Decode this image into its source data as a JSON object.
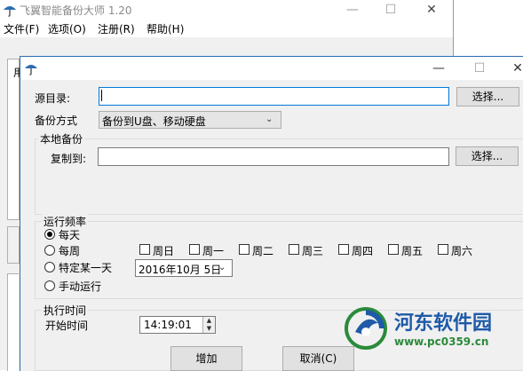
{
  "main_window": {
    "title": "飞翼智能备份大师 1.20",
    "controls": {
      "minimize": "—",
      "maximize": "☐",
      "close": "✕"
    },
    "menu": [
      {
        "label": "文件(F)"
      },
      {
        "label": "选项(O)"
      },
      {
        "label": "注册(R)"
      },
      {
        "label": "帮助(H)"
      }
    ],
    "panel_partial_label": "用"
  },
  "dialog": {
    "title": "",
    "controls": {
      "minimize": "—",
      "maximize": "☐",
      "close": "✕"
    },
    "source_dir": {
      "label": "源目录:",
      "value": "",
      "browse_label": "选择..."
    },
    "backup_mode": {
      "label": "备份方式",
      "selected": "备份到U盘、移动硬盘"
    },
    "local_backup": {
      "group_label": "本地备份",
      "copy_to_label": "复制到:",
      "copy_to_value": "",
      "browse_label": "选择..."
    },
    "frequency": {
      "group_label": "运行频率",
      "options": [
        {
          "label": "每天",
          "checked": true
        },
        {
          "label": "每周",
          "checked": false
        },
        {
          "label": "特定某一天",
          "checked": false
        },
        {
          "label": "手动运行",
          "checked": false
        }
      ],
      "weekdays": [
        {
          "label": "周日",
          "checked": false
        },
        {
          "label": "周一",
          "checked": false
        },
        {
          "label": "周二",
          "checked": false
        },
        {
          "label": "周三",
          "checked": false
        },
        {
          "label": "周四",
          "checked": false
        },
        {
          "label": "周五",
          "checked": false
        },
        {
          "label": "周六",
          "checked": false
        }
      ],
      "specific_date": "2016年10月  5日"
    },
    "exec_time": {
      "group_label": "执行时间",
      "start_label": "开始时间",
      "start_value": "14:19:01"
    },
    "buttons": {
      "add": "增加",
      "cancel": "取消(C)"
    }
  },
  "watermark": {
    "text": "河东软件园",
    "url": "www.pc0359.cn"
  },
  "colors": {
    "focus_border": "#0078d7",
    "dialog_border": "#2b6cb0",
    "watermark_blue": "#1e5aa8",
    "watermark_green": "#2a8a3a"
  }
}
